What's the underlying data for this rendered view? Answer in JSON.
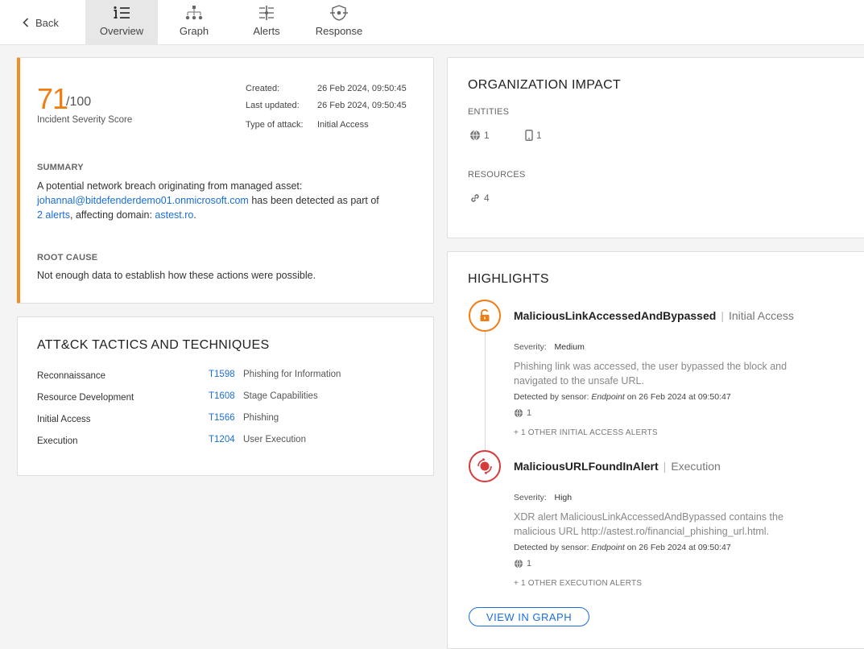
{
  "nav": {
    "back_label": "Back",
    "tabs": [
      {
        "label": "Overview",
        "icon": "list-icon",
        "active": true
      },
      {
        "label": "Graph",
        "icon": "graph-icon",
        "active": false
      },
      {
        "label": "Alerts",
        "icon": "alerts-icon",
        "active": false
      },
      {
        "label": "Response",
        "icon": "response-icon",
        "active": false
      }
    ]
  },
  "score": {
    "value": "71",
    "max": "/100",
    "label": "Incident Severity Score",
    "accent": "#f07d12"
  },
  "meta": {
    "created_label": "Created:",
    "created_value": "26 Feb 2024, 09:50:45",
    "updated_label": "Last updated:",
    "updated_value": "26 Feb 2024, 09:50:45",
    "attack_label": "Type of attack:",
    "attack_value": "Initial Access"
  },
  "summary": {
    "heading": "SUMMARY",
    "text_1": "A potential network breach originating from managed asset:",
    "asset_link": "johannal@bitdefenderdemo01.onmicrosoft.com",
    "text_2": "has been detected as part of",
    "alerts_link": "2 alerts",
    "text_3": ", affecting domain:",
    "domain_link": "astest.ro",
    "text_4": "."
  },
  "root_cause": {
    "heading": "ROOT CAUSE",
    "text": "Not enough data to establish how these actions were possible."
  },
  "tactics": {
    "title": "ATT&CK TACTICS AND TECHNIQUES",
    "rows": [
      {
        "tactic": "Reconnaissance",
        "id": "T1598",
        "technique": "Phishing for Information"
      },
      {
        "tactic": "Resource Development",
        "id": "T1608",
        "technique": "Stage Capabilities"
      },
      {
        "tactic": "Initial Access",
        "id": "T1566",
        "technique": "Phishing"
      },
      {
        "tactic": "Execution",
        "id": "T1204",
        "technique": "User Execution"
      }
    ]
  },
  "org_impact": {
    "title": "ORGANIZATION IMPACT",
    "entities_heading": "ENTITIES",
    "entities": [
      {
        "icon": "globe-icon",
        "count": "1"
      },
      {
        "icon": "mobile-device-icon",
        "count": "1"
      }
    ],
    "resources_heading": "RESOURCES",
    "resources": [
      {
        "icon": "link-icon",
        "count": "4"
      }
    ]
  },
  "highlights": {
    "title": "HIGHLIGHTS",
    "items": [
      {
        "icon": "unlocked-padlock-icon",
        "name": "MaliciousLinkAccessedAndBypassed",
        "category": "Initial Access",
        "severity_label": "Severity:",
        "severity": "Medium",
        "desc_1": "Phishing link was accessed, the user bypassed the block and",
        "desc_2": "navigated to the unsafe URL.",
        "detected_prefix": "Detected by sensor:",
        "sensor": "Endpoint",
        "detected_suffix": "on 26 Feb 2024 at 09:50:47",
        "entity_count": "1",
        "other": "+ 1 OTHER INITIAL ACCESS ALERTS",
        "color": "#f07d12"
      },
      {
        "icon": "target-icon",
        "name": "MaliciousURLFoundInAlert",
        "category": "Execution",
        "severity_label": "Severity:",
        "severity": "High",
        "desc_1": "XDR alert MaliciousLinkAccessedAndBypassed contains the",
        "desc_2": "malicious URL http://astest.ro/financial_phishing_url.html.",
        "detected_prefix": "Detected by sensor:",
        "sensor": "Endpoint",
        "detected_suffix": "on 26 Feb 2024 at 09:50:47",
        "entity_count": "1",
        "other": "+ 1 OTHER EXECUTION ALERTS",
        "color": "#d63a3a"
      }
    ],
    "view_button": "VIEW IN GRAPH"
  }
}
